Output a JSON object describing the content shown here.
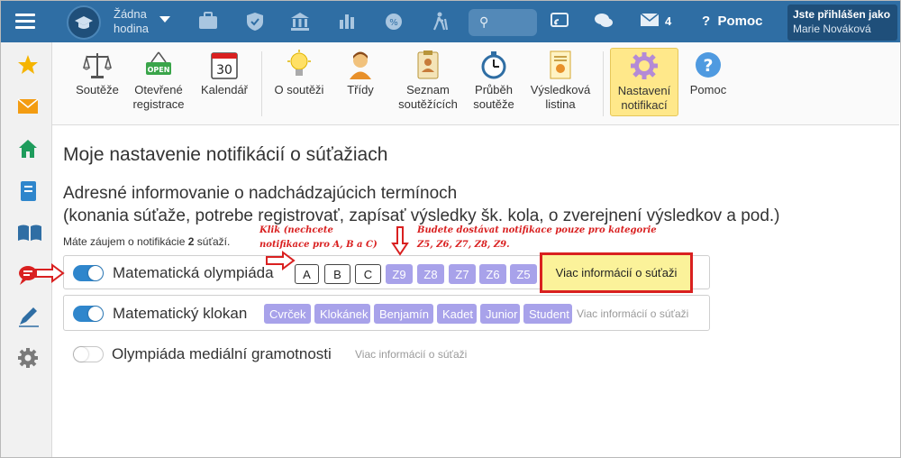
{
  "topbar": {
    "hour_line1": "Žádna",
    "hour_line2": "hodina",
    "mail_count": "4",
    "help_label": "Pomoc",
    "user_line1": "Jste přihlášen jako",
    "user_line2": "Marie Nováková",
    "icons": [
      "briefcase-icon",
      "shield-icon",
      "bank-icon",
      "bar-chart-icon",
      "badge-icon",
      "hiking-icon",
      "search-icon",
      "cast-icon",
      "chat-icon",
      "mail-icon",
      "help-icon"
    ]
  },
  "sidebar": {
    "icons": [
      "star-icon",
      "mail-icon",
      "home-icon",
      "notebook-icon",
      "open-book-icon",
      "chat-alert-icon",
      "pen-icon",
      "gear-icon"
    ]
  },
  "toolbar": {
    "items": [
      {
        "label1": "Soutěže",
        "label2": ""
      },
      {
        "label1": "Otevřené",
        "label2": "registrace",
        "icon_text": "OPEN"
      },
      {
        "label1": "Kalendář",
        "label2": "",
        "icon_text": "30"
      },
      {
        "label1": "O soutěži",
        "label2": ""
      },
      {
        "label1": "Třídy",
        "label2": ""
      },
      {
        "label1": "Seznam",
        "label2": "soutěžících"
      },
      {
        "label1": "Průběh",
        "label2": "soutěže"
      },
      {
        "label1": "Výsledková",
        "label2": "listina"
      },
      {
        "label1": "Nastavení",
        "label2": "notifikací"
      },
      {
        "label1": "Pomoc",
        "label2": ""
      }
    ]
  },
  "page": {
    "title": "Moje nastavenie notifikácií o súťažiach",
    "subtitle_line1": "Adresné informovanie o nadchádzajúcich termínoch",
    "subtitle_line2": "(konania súťaže, potrebe registrovať, zapísať výsledky šk. kola, o zverejnení výsledkov a pod.)",
    "interest_prefix": "Máte záujem o notifikácie",
    "interest_count": "2",
    "interest_suffix": "súťaží."
  },
  "competitions": [
    {
      "name": "Matematická olympiáda",
      "enabled": true,
      "categories": [
        {
          "label": "A",
          "selected": false
        },
        {
          "label": "B",
          "selected": false
        },
        {
          "label": "C",
          "selected": false
        },
        {
          "label": "Z9",
          "selected": true
        },
        {
          "label": "Z8",
          "selected": true
        },
        {
          "label": "Z7",
          "selected": true
        },
        {
          "label": "Z6",
          "selected": true
        },
        {
          "label": "Z5",
          "selected": true
        }
      ],
      "more": "Viac informácií o súťaži"
    },
    {
      "name": "Matematický klokan",
      "enabled": true,
      "categories": [
        {
          "label": "Cvrček",
          "selected": true
        },
        {
          "label": "Klokánek",
          "selected": true
        },
        {
          "label": "Benjamín",
          "selected": true
        },
        {
          "label": "Kadet",
          "selected": true
        },
        {
          "label": "Junior",
          "selected": true
        },
        {
          "label": "Student",
          "selected": true
        }
      ],
      "more": "Viac informácií o súťaži"
    },
    {
      "name": "Olympiáda mediální gramotnosti",
      "enabled": false,
      "categories": [],
      "more": "Viac informácií o súťaži"
    }
  ],
  "annotations": {
    "left_line1": "Klik (nechcete",
    "left_line2": "notifikace pro A, B a C)",
    "right_line1": "Budete dostávat notifikace pouze pro kategorie",
    "right_line2": "Z5, Z6, Z7, Z8, Z9."
  },
  "colors": {
    "topbar": "#2f6ea4",
    "toggle_on": "#2f86cc",
    "category_selected": "#a8a2ea",
    "highlight_button": "#fbf29a",
    "annotation": "#d92020"
  }
}
